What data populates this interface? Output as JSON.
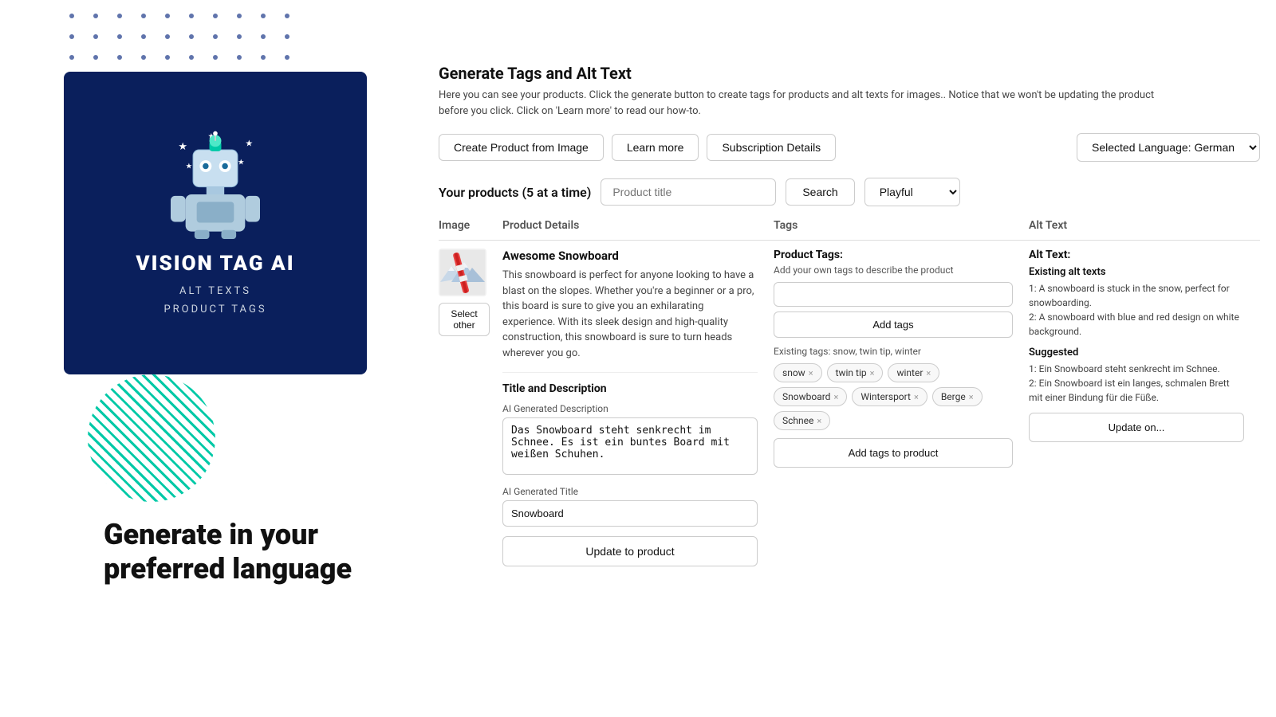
{
  "dotGrid": {
    "ariaLabel": "decorative dot grid"
  },
  "leftPanel": {
    "brandCard": {
      "title": "VISION TAG AI",
      "subtitle1": "ALT TEXTS",
      "subtitle2": "PRODUCT TAGS"
    },
    "tagline": "Generate in your preferred language"
  },
  "rightPanel": {
    "sectionTitle": "Generate Tags and Alt Text",
    "sectionDesc": "Here you can see your products. Click the generate button to create tags for products and alt texts for images.. Notice that we won't be updating the product before you click. Click on 'Learn more' to read our how-to.",
    "toolbar": {
      "createFromImage": "Create Product from Image",
      "learnMore": "Learn more",
      "subscriptionDetails": "Subscription Details",
      "selectedLanguage": "Selected Language: German"
    },
    "productsHeader": {
      "label": "Your products (5 at a time)",
      "searchPlaceholder": "Product title",
      "searchBtn": "Search",
      "styleOption": "Playful"
    },
    "tableHeaders": {
      "image": "Image",
      "productDetails": "Product Details",
      "tags": "Tags",
      "altText": "Alt Text"
    },
    "product": {
      "name": "Awesome Snowboard",
      "description": "This snowboard is perfect for anyone looking to have a blast on the slopes. Whether you're a beginner or a pro, this board is sure to give you an exhilarating experience. With its sleek design and high-quality construction, this snowboard is sure to turn heads wherever you go.",
      "selectOtherBtn": "Select other",
      "titleAndDescSection": "Title and Description",
      "aiGeneratedDescLabel": "AI Generated Description",
      "aiGeneratedDescValue": "Das Snowboard steht senkrecht im Schnee. Es ist ein buntes Board mit weißen Schuhen.",
      "aiGeneratedTitleLabel": "AI Generated Title",
      "aiGeneratedTitleValue": "Snowboard",
      "updateToProductBtn": "Update to product",
      "tagsSection": {
        "title": "Product Tags:",
        "helpText": "Add your own tags to describe the product",
        "inputPlaceholder": "",
        "addTagsBtn": "Add tags",
        "existingTagsLabel": "Existing tags: snow, twin tip, winter",
        "chips": [
          {
            "label": "snow"
          },
          {
            "label": "twin tip"
          },
          {
            "label": "winter"
          },
          {
            "label": "Snowboard"
          },
          {
            "label": "Wintersport"
          },
          {
            "label": "Berge"
          },
          {
            "label": "Schnee"
          }
        ],
        "addTagsProductBtn": "Add tags to product"
      },
      "altTextSection": {
        "title": "Alt Text:",
        "existingLabel": "Existing alt texts",
        "existingText": "1: A snowboard is stuck in the snow, perfect for snowboarding.\n2: A snowboard with blue and red design on white background.",
        "suggestedLabel": "Suggested",
        "suggestedText": "1: Ein Snowboard steht senkrecht im Schnee.\n2: Ein Snowboard ist ein langes, schmalen Brett mit einer Bindung für die Füße.",
        "updateOnBtn": "Update on..."
      }
    }
  }
}
